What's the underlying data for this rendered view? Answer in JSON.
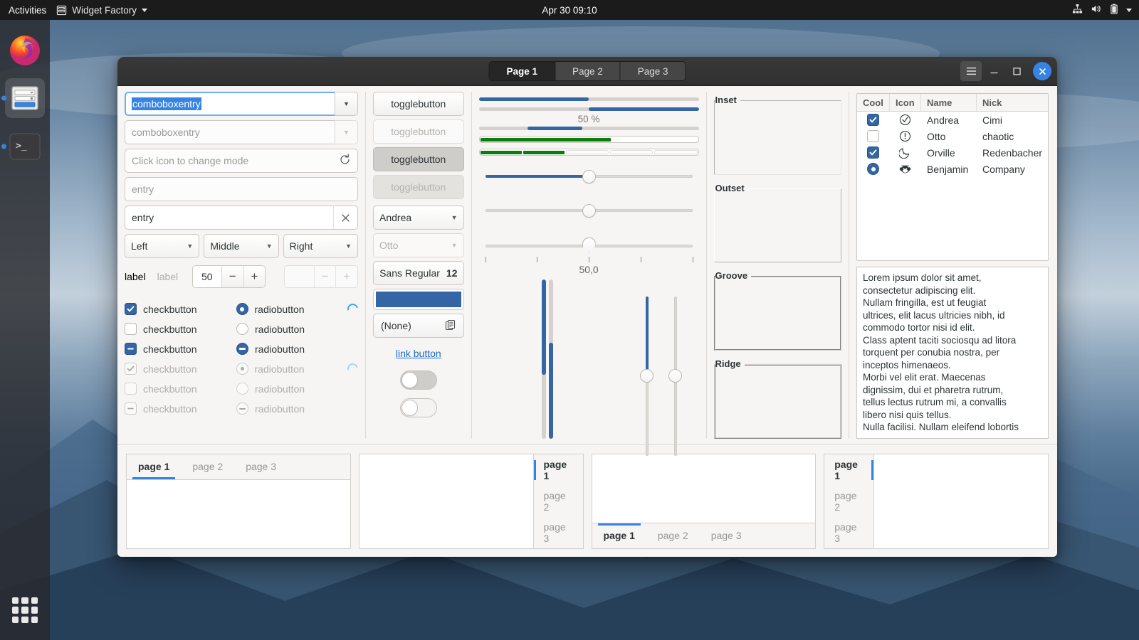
{
  "topbar": {
    "activities": "Activities",
    "app_name": "Widget Factory",
    "app_icon": "widget-factory-icon",
    "clock": "Apr 30  09:10",
    "tray_icons": [
      "network-icon",
      "volume-icon",
      "battery-icon",
      "chevron-down-icon"
    ]
  },
  "dock": {
    "items": [
      {
        "name": "firefox",
        "icon": "firefox-icon",
        "running": false
      },
      {
        "name": "widget-factory",
        "icon": "widget-factory-icon",
        "running": true
      },
      {
        "name": "terminal",
        "icon": "terminal-icon",
        "running": true
      }
    ],
    "show_apps": "show-applications-icon"
  },
  "window": {
    "header": {
      "stack_tabs": [
        {
          "label": "Page 1",
          "selected": true
        },
        {
          "label": "Page 2",
          "selected": false
        },
        {
          "label": "Page 3",
          "selected": false
        }
      ],
      "menu_icon": "hamburger-menu-icon",
      "minimize_icon": "minimize-icon",
      "maximize_icon": "maximize-icon",
      "close_icon": "close-icon",
      "close_color": "#3584e4"
    }
  },
  "column1": {
    "comboboxentry_focused": {
      "value": "comboboxentry",
      "selected": true
    },
    "comboboxentry_disabled": {
      "value": "comboboxentry"
    },
    "entry_icon_mode": {
      "placeholder": "Click icon to change mode",
      "icon": "refresh-icon"
    },
    "entry_empty": {
      "placeholder": "entry"
    },
    "entry_filled": {
      "value": "entry",
      "icon": "clear-icon"
    },
    "combos": [
      {
        "label": "Left"
      },
      {
        "label": "Middle"
      },
      {
        "label": "Right"
      }
    ],
    "label_enabled": "label",
    "label_disabled": "label",
    "spin_value": "50",
    "spin_minus": "−",
    "spin_plus": "+",
    "spin_disabled_value": "",
    "check_rows": [
      {
        "check_state": "on",
        "check_label": "checkbutton",
        "radio_state": "on",
        "radio_label": "radiobutton",
        "spinner": true,
        "disabled": false
      },
      {
        "check_state": "off",
        "check_label": "checkbutton",
        "radio_state": "off",
        "radio_label": "radiobutton",
        "spinner": false,
        "disabled": false
      },
      {
        "check_state": "mix",
        "check_label": "checkbutton",
        "radio_state": "mix",
        "radio_label": "radiobutton",
        "spinner": false,
        "disabled": false
      },
      {
        "check_state": "on",
        "check_label": "checkbutton",
        "radio_state": "on",
        "radio_label": "radiobutton",
        "spinner": true,
        "disabled": true
      },
      {
        "check_state": "off",
        "check_label": "checkbutton",
        "radio_state": "off",
        "radio_label": "radiobutton",
        "spinner": false,
        "disabled": true
      },
      {
        "check_state": "mix",
        "check_label": "checkbutton",
        "radio_state": "mix",
        "radio_label": "radiobutton",
        "spinner": false,
        "disabled": true
      }
    ]
  },
  "column2": {
    "toggles": [
      {
        "label": "togglebutton",
        "state": "normal"
      },
      {
        "label": "togglebutton",
        "state": "disabled"
      },
      {
        "label": "togglebutton",
        "state": "active"
      },
      {
        "label": "togglebutton",
        "state": "active-disabled"
      }
    ],
    "combo_enabled": "Andrea",
    "combo_disabled": "Otto",
    "font_button": {
      "family": "Sans Regular",
      "size": "12"
    },
    "color_button": {
      "color": "#3465a4",
      "name": "color-button"
    },
    "file_button": {
      "label": "(None)",
      "icon": "document-open-icon"
    },
    "link_button": "link button",
    "switch_on": {
      "state": "on"
    },
    "switch_off": {
      "state": "off"
    }
  },
  "column3": {
    "progress_ltr": {
      "value": 50,
      "name": "progressbar-ltr"
    },
    "progress_rtl": {
      "value": 50,
      "name": "progressbar-rtl"
    },
    "progress_text": "50 %",
    "progress_mid": {
      "value": 25,
      "offset": 22,
      "name": "progressbar-middle"
    },
    "levelbar_continuous": {
      "value": 60
    },
    "levelbar_discrete": {
      "segments": [
        true,
        true,
        false,
        false,
        false
      ]
    },
    "scale_filled": {
      "value": 50,
      "name": "scale-horizontal"
    },
    "scale_plain": {
      "value": 50,
      "name": "scale-horizontal-noflll"
    },
    "scale_marks": {
      "value": 50,
      "name": "scale-with-marks",
      "marks": [
        0,
        25,
        50,
        75,
        100
      ]
    },
    "scale_value_text": "50,0",
    "vprogress_a": {
      "value": 60,
      "name": "vertical-progress-a"
    },
    "vprogress_b": {
      "value": 60,
      "name": "vertical-progress-b",
      "inverted": true
    },
    "vscale_filled": {
      "value": 50,
      "name": "vertical-scale-filled"
    },
    "vscale_plain": {
      "value": 50,
      "name": "vertical-scale-plain"
    }
  },
  "column4": {
    "frames": [
      {
        "label": "Inset",
        "style": "inset"
      },
      {
        "label": "Outset",
        "style": "outset"
      },
      {
        "label": "Groove",
        "style": "groove"
      },
      {
        "label": "Ridge",
        "style": "ridge"
      }
    ]
  },
  "column5": {
    "treeview": {
      "headers": [
        "Cool",
        "Icon",
        "Name",
        "Nick"
      ],
      "rows": [
        {
          "cool": "checked",
          "icon": "check-circle-icon",
          "name": "Andrea",
          "nick": "Cimi"
        },
        {
          "cool": "unchecked",
          "icon": "warning-circle-icon",
          "name": "Otto",
          "nick": "chaotic"
        },
        {
          "cool": "checked",
          "icon": "sleep-face-icon",
          "name": "Orville",
          "nick": "Redenbacher"
        },
        {
          "cool": "radio",
          "icon": "monkey-face-icon",
          "name": "Benjamin",
          "nick": "Company"
        }
      ]
    },
    "textview": {
      "lines": [
        "Lorem ipsum dolor sit amet,",
        "consectetur adipiscing elit.",
        "Nullam fringilla, est ut feugiat",
        "ultrices, elit lacus ultricies nibh, id",
        "commodo tortor nisi id elit.",
        "Class aptent taciti sociosqu ad litora",
        "torquent per conubia nostra, per",
        "inceptos himenaeos.",
        "Morbi vel elit erat. Maecenas",
        "dignissim, dui et pharetra rutrum,",
        "tellus lectus rutrum mi, a convallis",
        "libero nisi quis tellus.",
        "Nulla facilisi. Nullam eleifend lobortis"
      ]
    }
  },
  "notebooks": [
    {
      "name": "notebook-tabs-top",
      "position": "top",
      "tabs": [
        {
          "label": "page 1",
          "selected": true
        },
        {
          "label": "page 2",
          "selected": false
        },
        {
          "label": "page 3",
          "selected": false
        }
      ]
    },
    {
      "name": "notebook-tabs-right",
      "position": "right",
      "tabs": [
        {
          "label": "page 1",
          "selected": true
        },
        {
          "label": "page 2",
          "selected": false
        },
        {
          "label": "page 3",
          "selected": false
        }
      ]
    },
    {
      "name": "notebook-tabs-bottom",
      "position": "bottom",
      "tabs": [
        {
          "label": "page 1",
          "selected": true
        },
        {
          "label": "page 2",
          "selected": false
        },
        {
          "label": "page 3",
          "selected": false
        }
      ]
    },
    {
      "name": "notebook-tabs-left",
      "position": "left",
      "tabs": [
        {
          "label": "page 1",
          "selected": true
        },
        {
          "label": "page 2",
          "selected": false
        },
        {
          "label": "page 3",
          "selected": false
        }
      ]
    }
  ]
}
